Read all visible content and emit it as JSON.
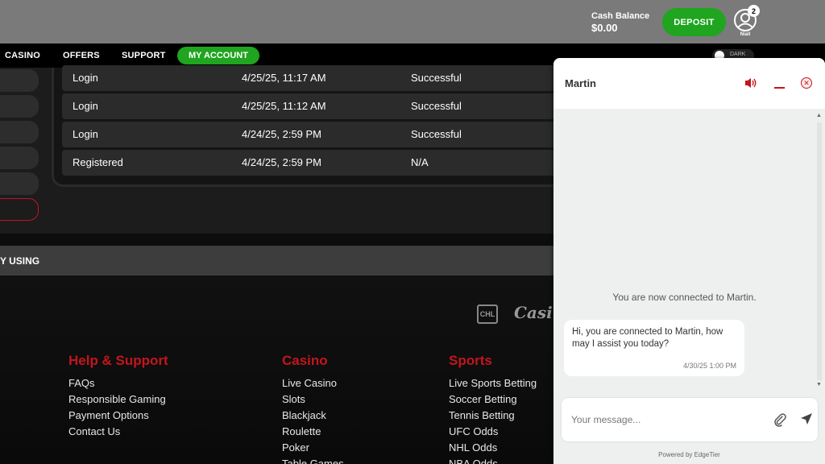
{
  "header": {
    "cash_label": "Cash Balance",
    "cash_value": "$0.00",
    "deposit_label": "DEPOSIT",
    "notification_count": "2",
    "user_name": "Niall"
  },
  "nav": {
    "items": [
      "CASINO",
      "OFFERS",
      "SUPPORT"
    ],
    "account_label": "MY ACCOUNT",
    "theme_label": "DARK"
  },
  "activity": {
    "rows": [
      {
        "event": "Login",
        "date": "4/25/25, 11:17 AM",
        "status": "Successful"
      },
      {
        "event": "Login",
        "date": "4/25/25, 11:12 AM",
        "status": "Successful"
      },
      {
        "event": "Login",
        "date": "4/24/25, 2:59 PM",
        "status": "Successful"
      },
      {
        "event": "Registered",
        "date": "4/24/25, 2:59 PM",
        "status": "N/A"
      }
    ]
  },
  "bar": {
    "text": "Y USING"
  },
  "footer": {
    "logos": [
      "CHL",
      "Casin"
    ],
    "help": {
      "title": "Help & Support",
      "links": [
        "FAQs",
        "Responsible Gaming",
        "Payment Options",
        "Contact Us"
      ]
    },
    "casino": {
      "title": "Casino",
      "links": [
        "Live Casino",
        "Slots",
        "Blackjack",
        "Roulette",
        "Poker",
        "Table Games"
      ]
    },
    "sports": {
      "title": "Sports",
      "links": [
        "Live Sports Betting",
        "Soccer Betting",
        "Tennis Betting",
        "UFC Odds",
        "NHL Odds",
        "NBA Odds"
      ]
    }
  },
  "chat": {
    "agent_name": "Martin",
    "connected_notice": "You are now connected to Martin.",
    "message_text": "Hi, you are connected to Martin, how may I assist you today?",
    "message_time": "4/30/25 1:00 PM",
    "input_placeholder": "Your message...",
    "powered_by": "Powered by EdgeTier"
  },
  "colors": {
    "accent_green": "#1fa51f",
    "brand_red": "#c3151d"
  }
}
